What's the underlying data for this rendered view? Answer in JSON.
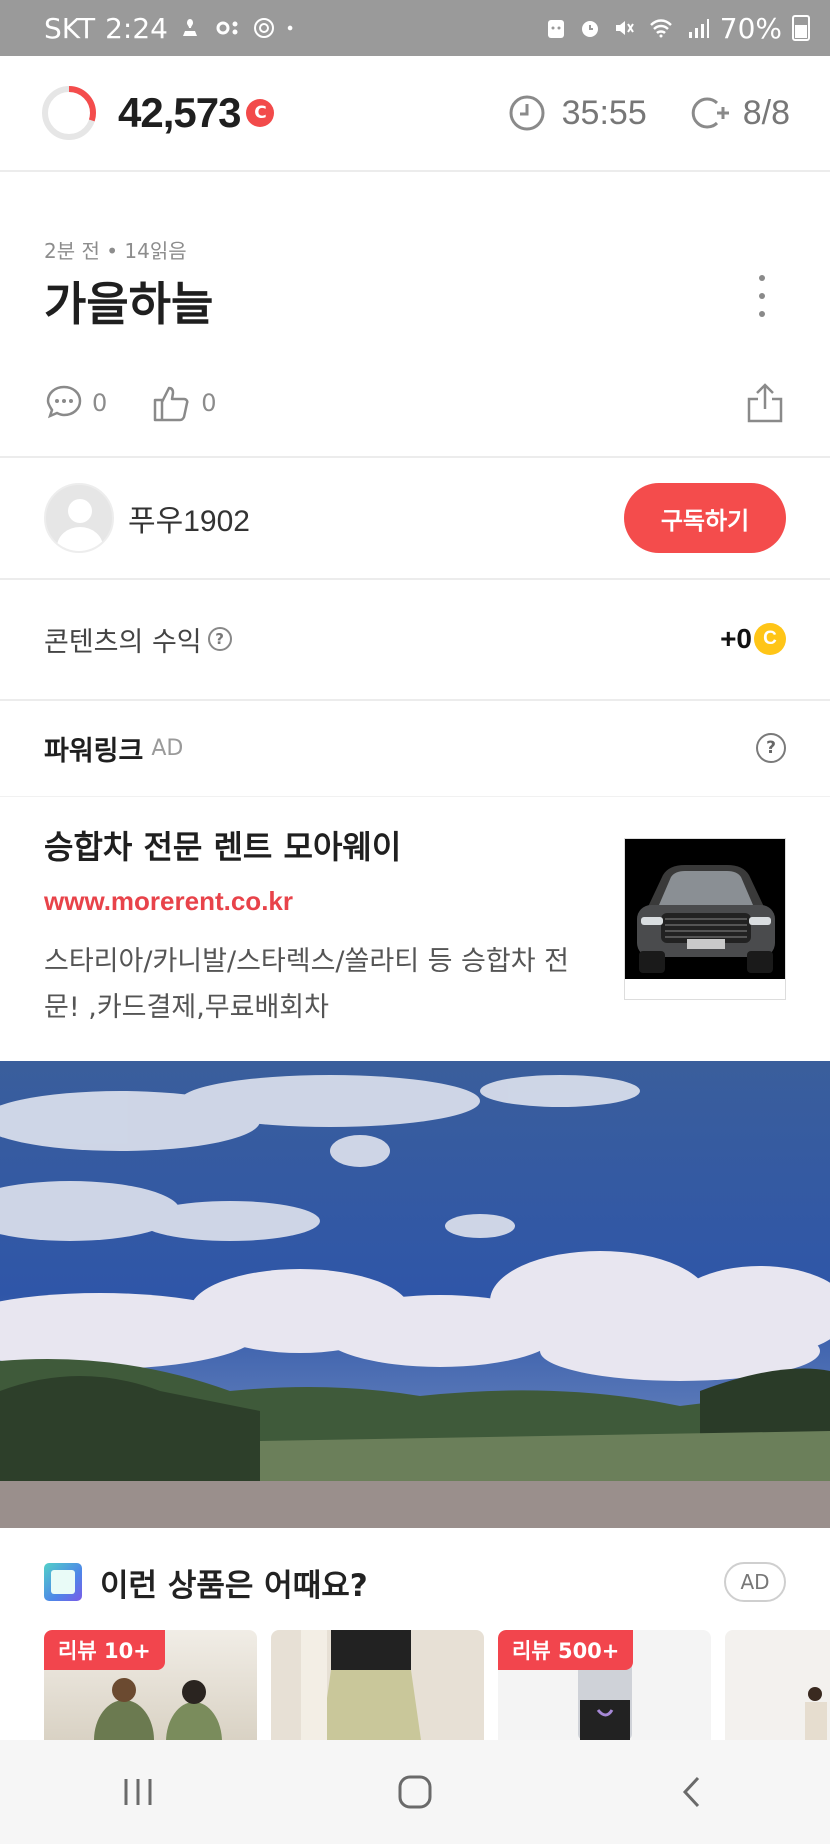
{
  "status_bar": {
    "carrier": "SKT",
    "time": "2:24",
    "battery": "70%",
    "icons": [
      "notification-icon",
      "toggle-icon",
      "settings-icon",
      "dot-icon",
      "face-icon",
      "alarm-icon",
      "mute-icon",
      "wifi-icon",
      "signal-icon",
      "battery-icon"
    ]
  },
  "summary": {
    "points": "42,573",
    "coin_symbol": "C",
    "timer": "35:55",
    "counter": "8/8",
    "ring_progress": 0.3
  },
  "article": {
    "meta": "2분 전 • 14읽음",
    "title": "가을하늘",
    "comments": "0",
    "likes": "0"
  },
  "author": {
    "name": "푸우1902",
    "subscribe_label": "구독하기"
  },
  "revenue": {
    "label": "콘텐츠의 수익",
    "help": "?",
    "value": "+0",
    "coin_symbol": "C"
  },
  "powerlink": {
    "title": "파워링크",
    "ad_label": "AD",
    "help": "?",
    "ad": {
      "title": "승합차 전문 렌트 모아웨이",
      "url": "www.morerent.co.kr",
      "description": "스타리아/카니발/스타렉스/쏠라티 등 승합차 전문! ,카드결제,무료배회차"
    }
  },
  "recommend": {
    "title": "이런 상품은 어때요?",
    "ad_pill": "AD",
    "cards": [
      {
        "badge": "리뷰 10+"
      },
      {
        "badge": ""
      },
      {
        "badge": "리뷰 500+"
      },
      {
        "badge": ""
      }
    ]
  },
  "colors": {
    "accent": "#f44c4c",
    "coin": "#ffc517",
    "link": "#e8434a"
  }
}
